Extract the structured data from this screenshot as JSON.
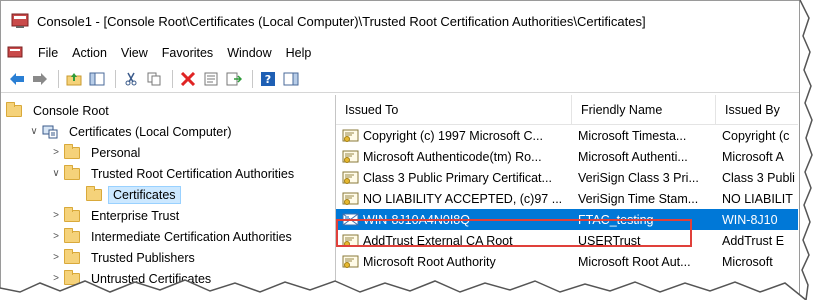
{
  "window": {
    "title": "Console1 - [Console Root\\Certificates (Local Computer)\\Trusted Root Certification Authorities\\Certificates]"
  },
  "menu": [
    "File",
    "Action",
    "View",
    "Favorites",
    "Window",
    "Help"
  ],
  "toolbar": {
    "icons": [
      "back-arrow-icon",
      "forward-arrow-icon",
      "up-folder-icon",
      "show-hide-tree-icon",
      "cut-icon",
      "copy-icon",
      "delete-icon",
      "properties-icon",
      "export-icon",
      "help-icon",
      "action-pane-icon"
    ]
  },
  "tree": {
    "items": [
      {
        "label": "Console Root",
        "indent": 0,
        "chevron": "",
        "icon": "folder"
      },
      {
        "label": "Certificates (Local Computer)",
        "indent": 1,
        "chevron": "∨",
        "icon": "computer"
      },
      {
        "label": "Personal",
        "indent": 2,
        "chevron": ">",
        "icon": "folder"
      },
      {
        "label": "Trusted Root Certification Authorities",
        "indent": 2,
        "chevron": "∨",
        "icon": "folder"
      },
      {
        "label": "Certificates",
        "indent": 3,
        "chevron": "",
        "icon": "folder",
        "selected": true
      },
      {
        "label": "Enterprise Trust",
        "indent": 2,
        "chevron": ">",
        "icon": "folder"
      },
      {
        "label": "Intermediate Certification Authorities",
        "indent": 2,
        "chevron": ">",
        "icon": "folder"
      },
      {
        "label": "Trusted Publishers",
        "indent": 2,
        "chevron": ">",
        "icon": "folder"
      },
      {
        "label": "Untrusted Certificates",
        "indent": 2,
        "chevron": ">",
        "icon": "folder"
      }
    ]
  },
  "list": {
    "columns": [
      "Issued To",
      "Friendly Name",
      "Issued By"
    ],
    "rows": [
      {
        "issued_to": "Copyright (c) 1997 Microsoft C...",
        "friendly_name": "Microsoft Timesta...",
        "issued_by": "Copyright (c"
      },
      {
        "issued_to": "Microsoft Authenticode(tm) Ro...",
        "friendly_name": "Microsoft Authenti...",
        "issued_by": "Microsoft A"
      },
      {
        "issued_to": "Class 3 Public Primary Certificat...",
        "friendly_name": "VeriSign Class 3 Pri...",
        "issued_by": "Class 3 Publi"
      },
      {
        "issued_to": "NO LIABILITY ACCEPTED, (c)97 ...",
        "friendly_name": "VeriSign Time Stam...",
        "issued_by": "NO LIABILIT"
      },
      {
        "issued_to": "WIN-8J10A4N0I8Q",
        "friendly_name": "FTAC_testing",
        "issued_by": "WIN-8J10",
        "selected": true
      },
      {
        "issued_to": "AddTrust External CA Root",
        "friendly_name": "USERTrust",
        "issued_by": "AddTrust E"
      },
      {
        "issued_to": "Microsoft Root Authority",
        "friendly_name": "Microsoft Root Aut...",
        "issued_by": "Microsoft"
      }
    ]
  },
  "colors": {
    "selection": "#0078d7",
    "highlight": "#e0403a",
    "tree_selection": "#cce8ff"
  }
}
